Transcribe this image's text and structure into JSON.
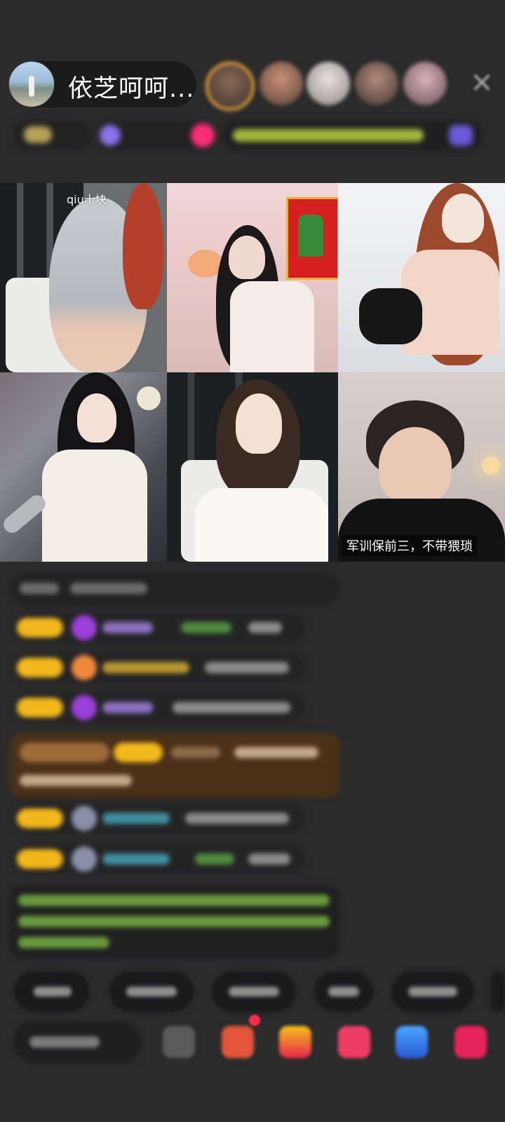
{
  "header": {
    "host_name": "依芝呵呵...",
    "close_icon": "close-icon"
  },
  "grid": {
    "cells": [
      {
        "label": "qiu十块"
      },
      {
        "label": ""
      },
      {
        "label": ""
      },
      {
        "label": ""
      },
      {
        "label": ""
      },
      {
        "caption": "军训保前三，不带猥琐"
      }
    ]
  },
  "colors": {
    "background": "#2b2b2c",
    "badge_gold": "#f3b81c",
    "accent_pink": "#ff2d78"
  }
}
